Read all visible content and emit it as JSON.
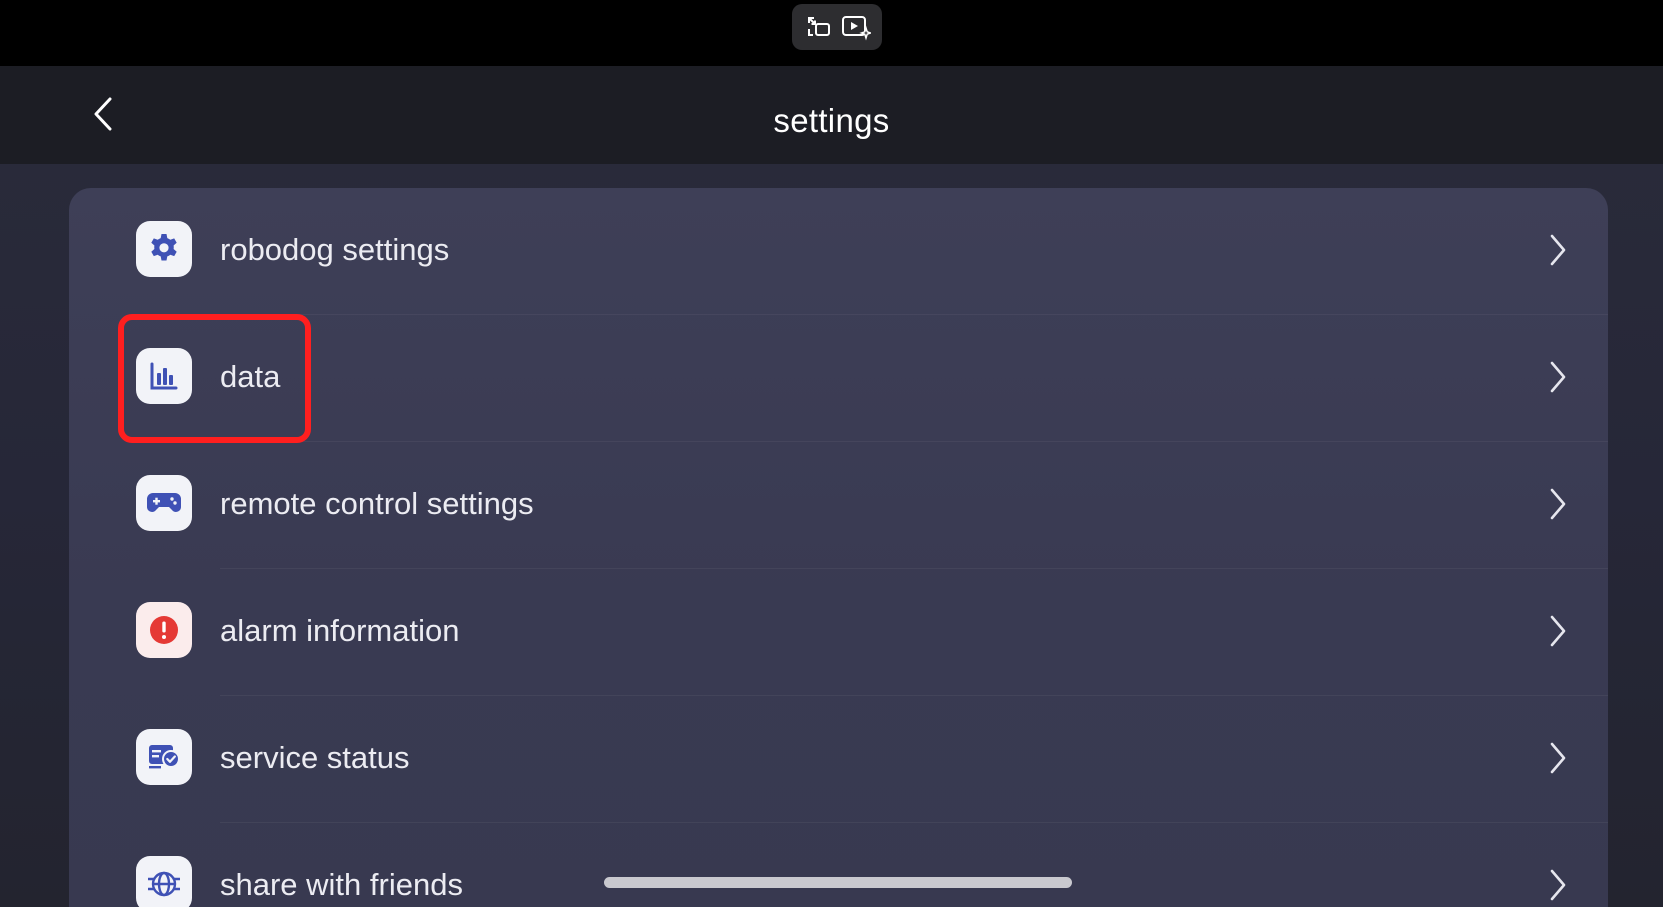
{
  "topbar": {
    "pill_icons": [
      "exit-fullscreen-icon",
      "video-sparkle-icon"
    ]
  },
  "header": {
    "back_icon": "chevron-left-icon",
    "title": "settings"
  },
  "settings_items": [
    {
      "label": "robodog settings",
      "icon": "gear-icon",
      "icon_color": "#3f51b5"
    },
    {
      "label": "data",
      "icon": "bar-chart-icon",
      "icon_color": "#3f51b5"
    },
    {
      "label": "remote control settings",
      "icon": "gamepad-icon",
      "icon_color": "#3f51b5"
    },
    {
      "label": "alarm information",
      "icon": "alert-circle-icon",
      "icon_color": "#e53935"
    },
    {
      "label": "service status",
      "icon": "service-check-icon",
      "icon_color": "#3f51b5"
    },
    {
      "label": "share with friends",
      "icon": "globe-share-icon",
      "icon_color": "#3f51b5"
    }
  ],
  "highlight": {
    "target": "data",
    "color": "#ff1f1f"
  },
  "colors": {
    "background": "#262738",
    "header": "#1c1d24",
    "card": "#3c3d55",
    "text": "#ececf2",
    "accent": "#3f51b5",
    "alarm": "#e53935"
  }
}
